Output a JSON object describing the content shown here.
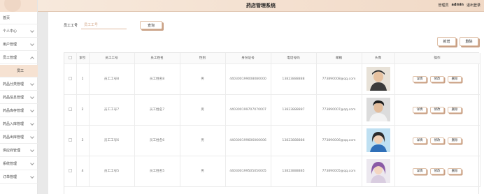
{
  "app": {
    "title": "药店管理系统",
    "role": "管理员",
    "username": "admin",
    "logout": "退出登录"
  },
  "sidebar": {
    "items": [
      {
        "label": "首页",
        "expandable": false
      },
      {
        "label": "个人中心",
        "expandable": true
      },
      {
        "label": "用户管理",
        "expandable": true
      },
      {
        "label": "员工管理",
        "expandable": true,
        "open": true
      },
      {
        "label": "员工",
        "sub": true
      },
      {
        "label": "药品分类管理",
        "expandable": true
      },
      {
        "label": "药品信息管理",
        "expandable": true
      },
      {
        "label": "药品库存管理",
        "expandable": true
      },
      {
        "label": "药品入库管理",
        "expandable": true
      },
      {
        "label": "药品出库管理",
        "expandable": true
      },
      {
        "label": "供应商管理",
        "expandable": true
      },
      {
        "label": "系统管理",
        "expandable": true
      },
      {
        "label": "订单管理",
        "expandable": true
      }
    ]
  },
  "search": {
    "label": "员工工号",
    "placeholder": "员工工号",
    "button": "查询"
  },
  "actions": {
    "add": "新增",
    "delete": "删除"
  },
  "table": {
    "headers": [
      "",
      "索引",
      "员工工号",
      "员工姓名",
      "性别",
      "身份证号",
      "电话号码",
      "邮箱",
      "头像",
      "操作"
    ],
    "row_actions": {
      "detail": "详情",
      "edit": "修改",
      "delete": "删除"
    },
    "rows": [
      {
        "index": "1",
        "emp_no": "员工工号8",
        "name": "员工姓名8",
        "gender": "男",
        "id_card": "440300199008080000",
        "phone": "13823888888",
        "email": "773890008@qq.com",
        "avatar": "avatar-boy-hat"
      },
      {
        "index": "2",
        "emp_no": "员工工号7",
        "name": "员工姓名7",
        "gender": "男",
        "id_card": "440300199707070007",
        "phone": "13823888887",
        "email": "773890007@qq.com",
        "avatar": "avatar-boy-portrait"
      },
      {
        "index": "3",
        "emp_no": "员工工号6",
        "name": "员工姓名6",
        "gender": "男",
        "id_card": "440300199606060006",
        "phone": "13823888886",
        "email": "773890006@qq.com",
        "avatar": "avatar-girl-blue"
      },
      {
        "index": "4",
        "emp_no": "员工工号5",
        "name": "员工姓名5",
        "gender": "男",
        "id_card": "440300199505050005",
        "phone": "13823888885",
        "email": "773890005@qq.com",
        "avatar": "avatar-girl-purple"
      }
    ]
  },
  "colors": {
    "accent": "#f6e2d2",
    "button_shadow": "#c9a085",
    "button_border": "#e0c2aa"
  }
}
